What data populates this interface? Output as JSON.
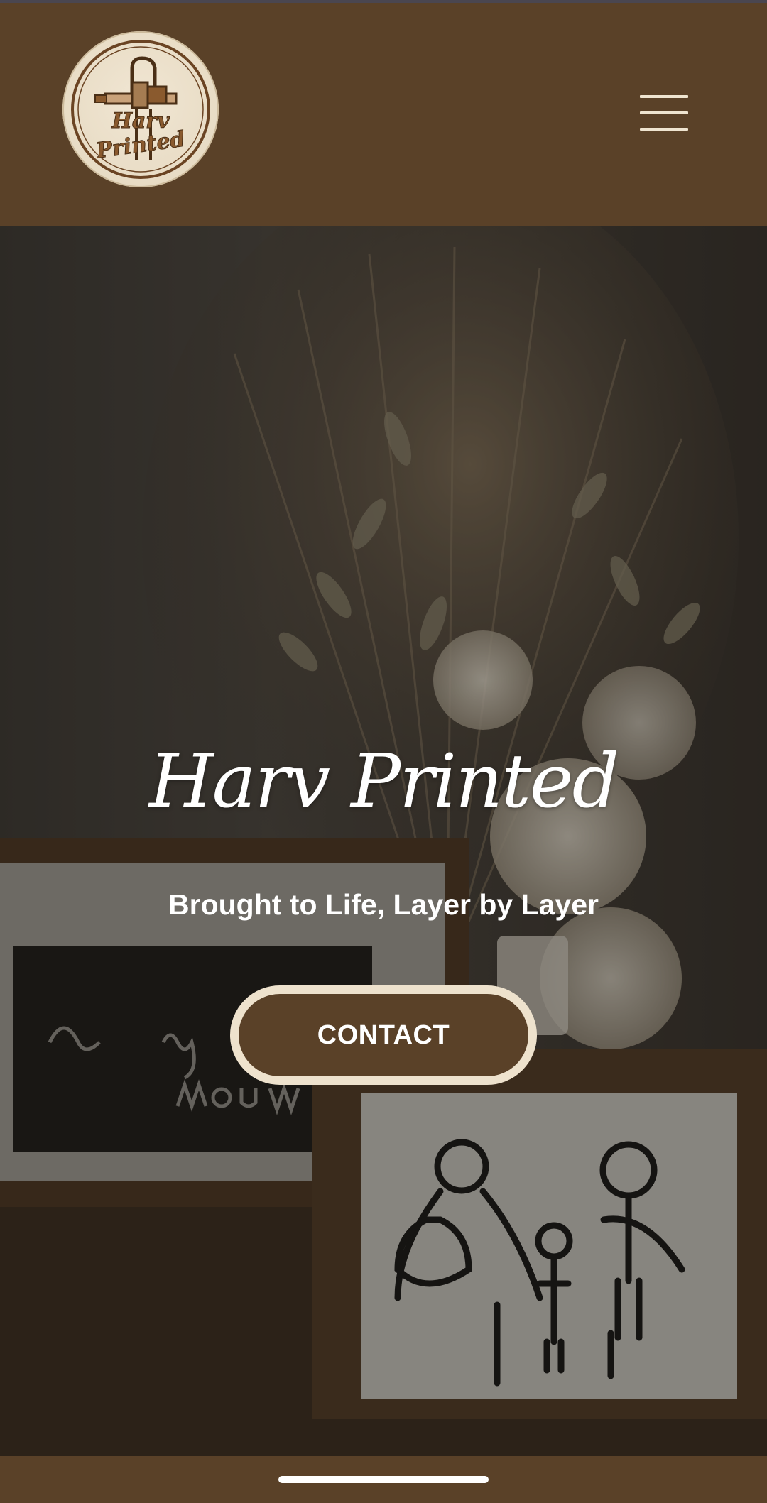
{
  "colors": {
    "brand_brown": "#5a4128",
    "cream": "#eee2cd",
    "text_light": "#ffffff"
  },
  "header": {
    "logo_text_line1": "Harv",
    "logo_text_line2": "Printed",
    "menu_icon": "hamburger-menu-icon"
  },
  "hero": {
    "title": "Harv Printed",
    "subtitle": "Brought to Life, Layer by Layer",
    "cta_label": "CONTACT"
  }
}
